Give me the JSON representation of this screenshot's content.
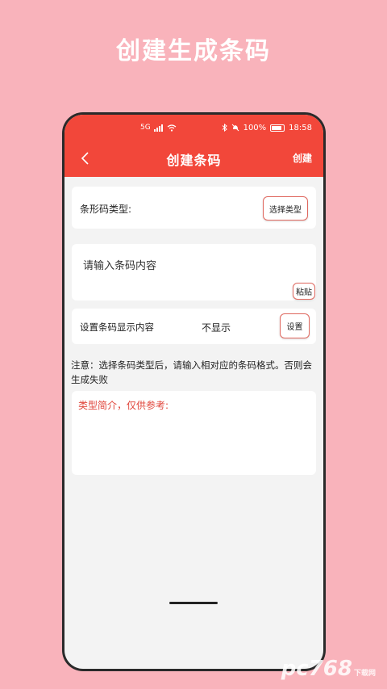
{
  "promo": {
    "title": "创建生成条码"
  },
  "status": {
    "network": "5G",
    "battery_percent": "100%",
    "time": "18:58"
  },
  "header": {
    "title": "创建条码",
    "action_label": "创建"
  },
  "barcode_type": {
    "label": "条形码类型:",
    "button_label": "选择类型"
  },
  "content_input": {
    "placeholder": "请输入条码内容",
    "paste_label": "粘贴"
  },
  "display_setting": {
    "label": "设置条码显示内容",
    "value": "不显示",
    "button_label": "设置"
  },
  "note": "注意：选择条码类型后，请输入相对应的条码格式。否则会生成失败",
  "type_intro": {
    "title": "类型简介，仅供参考:"
  },
  "watermark": {
    "text": "pc768",
    "sub": "下载网"
  },
  "colors": {
    "background": "#f9b3bb",
    "accent": "#f2473a"
  }
}
